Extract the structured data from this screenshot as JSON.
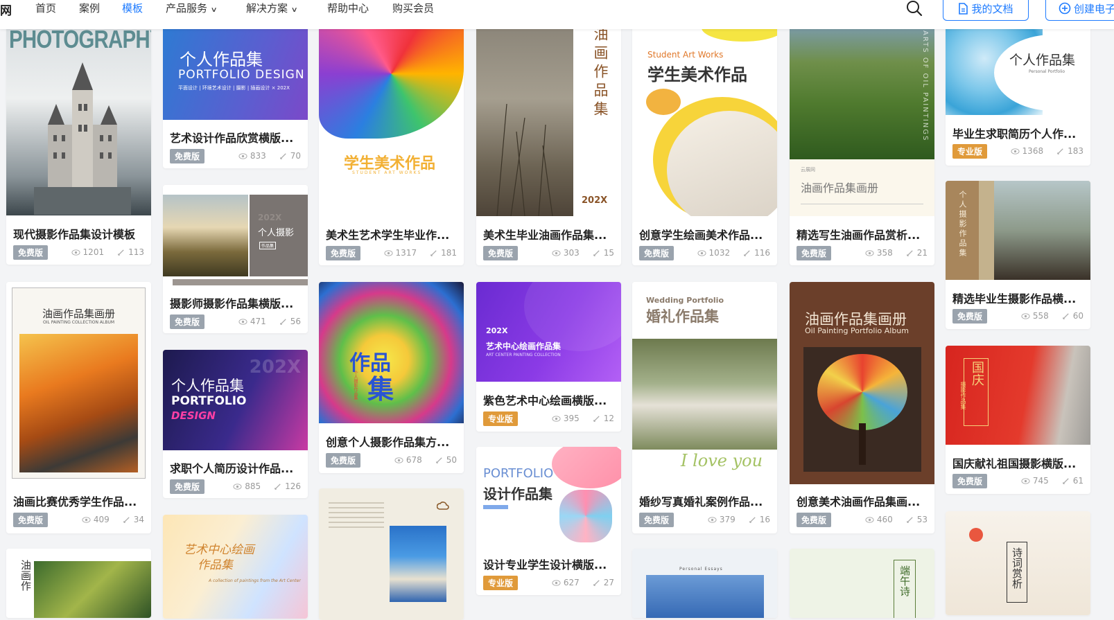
{
  "nav": {
    "logo_fragment": "网",
    "items": [
      {
        "label": "首页"
      },
      {
        "label": "案例"
      },
      {
        "label": "模板",
        "active": true
      },
      {
        "label": "产品服务"
      },
      {
        "label": "解决方案"
      },
      {
        "label": "帮助中心"
      },
      {
        "label": "购买会员"
      }
    ],
    "my_docs": "我的文档",
    "create": "创建电子"
  },
  "colors": {
    "accent": "#1e7bff",
    "free_badge": "#9aa3ad",
    "pro_badge": "#e09a3a"
  },
  "cards": [
    {
      "title": "现代摄影作品集设计模板",
      "badge": "免费版",
      "views": "1201",
      "uses": "113",
      "thumb": {
        "t1": "PHOTOGRAPHY"
      }
    },
    {
      "title": "油画比赛优秀学生作品...",
      "badge": "免费版",
      "views": "409",
      "uses": "34",
      "thumb": {
        "t1": "油画作品集画册",
        "t2": "OIL PAINTING COLLECTION ALBUM"
      }
    },
    {
      "title": "",
      "badge": "",
      "views": "",
      "uses": "",
      "thumb": {
        "t1": "油画作"
      }
    },
    {
      "title": "艺术设计作品欣赏横版...",
      "badge": "免费版",
      "views": "833",
      "uses": "70",
      "thumb": {
        "t1": "个人作品集",
        "t2": "PORTFOLIO DESIGN",
        "t3": "平面设计 | 环境艺术设计 | 摄影 | 插画设计  × 202X"
      }
    },
    {
      "title": "摄影师摄影作品集横版...",
      "badge": "免费版",
      "views": "471",
      "uses": "56",
      "thumb": {
        "t1": "个人摄影",
        "t2": "作品集",
        "t3": "202X"
      }
    },
    {
      "title": "求职个人简历设计作品...",
      "badge": "免费版",
      "views": "885",
      "uses": "126",
      "thumb": {
        "t1": "个人作品集",
        "t2": "PORTFOLIO",
        "t3": "DESIGN",
        "t4": "202X"
      }
    },
    {
      "title": "",
      "badge": "",
      "views": "",
      "uses": "",
      "thumb": {
        "t1": "艺术中心绘画",
        "t2": "作品集",
        "t3": "A collection of paintings from the Art Center"
      }
    },
    {
      "title": "美术生艺术学生毕业作...",
      "badge": "免费版",
      "views": "1317",
      "uses": "181",
      "thumb": {
        "t1": "学生美术作品",
        "t2": "STUDENT ART WORKS"
      }
    },
    {
      "title": "创意个人摄影作品集方...",
      "badge": "免费版",
      "views": "678",
      "uses": "50",
      "thumb": {
        "t1": "作品",
        "t2": "集",
        "t3": "个人摄影作品集"
      }
    },
    {
      "title": "",
      "badge": "",
      "views": "",
      "uses": "",
      "thumb": {}
    },
    {
      "title": "美术生毕业油画作品集...",
      "badge": "免费版",
      "views": "303",
      "uses": "15",
      "thumb": {
        "t1": "油画作品集",
        "t2": "202X"
      }
    },
    {
      "title": "紫色艺术中心绘画横版...",
      "badge": "专业版",
      "views": "395",
      "uses": "12",
      "thumb": {
        "t1": "202X",
        "t2": "艺术中心绘画作品集",
        "t3": "ART CENTER PAINTING COLLECTION"
      }
    },
    {
      "title": "设计专业学生设计横版...",
      "badge": "专业版",
      "views": "627",
      "uses": "27",
      "thumb": {
        "t1": "PORTFOLIO",
        "t2": "设计作品集"
      }
    },
    {
      "title": "创意学生绘画美术作品...",
      "badge": "免费版",
      "views": "1032",
      "uses": "116",
      "thumb": {
        "t1": "Student Art Works",
        "t2": "学生美术作品"
      }
    },
    {
      "title": "婚纱写真婚礼案例作品...",
      "badge": "免费版",
      "views": "379",
      "uses": "16",
      "thumb": {
        "t1": "Wedding Portfolio",
        "t2": "婚礼作品集",
        "t3": "I love you"
      }
    },
    {
      "title": "",
      "badge": "",
      "views": "",
      "uses": "",
      "thumb": {
        "t1": "Personal Essays"
      }
    },
    {
      "title": "精选写生油画作品赏析...",
      "badge": "免费版",
      "views": "358",
      "uses": "21",
      "thumb": {
        "t1": "油画作品集画册",
        "t2": "云展网",
        "t3": "ARTS OF OIL PAINTINGS"
      }
    },
    {
      "title": "创意美术油画作品集画...",
      "badge": "免费版",
      "views": "460",
      "uses": "53",
      "thumb": {
        "t1": "油画作品集画册",
        "t2": "Oil Painting Portfolio Album"
      }
    },
    {
      "title": "",
      "badge": "",
      "views": "",
      "uses": "",
      "thumb": {
        "t1": "端午诗"
      }
    },
    {
      "title": "毕业生求职简历个人作...",
      "badge": "专业版",
      "views": "1368",
      "uses": "183",
      "thumb": {
        "t1": "个人作品集",
        "t2": "Personal Portfolio"
      }
    },
    {
      "title": "精选毕业生摄影作品横...",
      "badge": "免费版",
      "views": "558",
      "uses": "60",
      "thumb": {
        "t1": "个人摄影作品集"
      }
    },
    {
      "title": "国庆献礼祖国摄影横版...",
      "badge": "免费版",
      "views": "745",
      "uses": "61",
      "thumb": {
        "t1": "国庆",
        "t2": "摄影作品集"
      }
    },
    {
      "title": "",
      "badge": "",
      "views": "",
      "uses": "",
      "thumb": {
        "t1": "诗词赏析"
      }
    }
  ]
}
